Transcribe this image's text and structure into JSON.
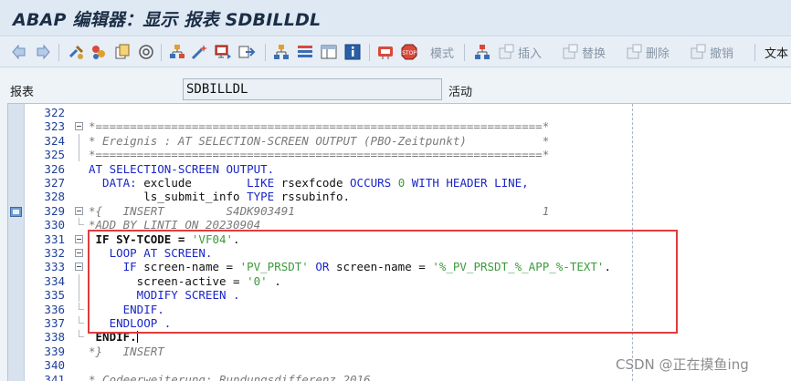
{
  "window": {
    "title": "ABAP 编辑器：显示 报表 SDBILLDL"
  },
  "toolbar": {
    "icons": [
      "back-arrow-icon",
      "forward-arrow-icon",
      "tools-icon",
      "object-list-icon",
      "copy-icon",
      "navigate-icon",
      "hierarchy-icon",
      "magic-wand-icon",
      "screen-icon",
      "enter-icon",
      "tree-icon",
      "list-icon",
      "panel-icon",
      "info-icon",
      "pattern-icon",
      "stop-icon",
      "insert-icon",
      "replace-icon",
      "delete-icon",
      "undo-icon"
    ],
    "pattern_label": "模式",
    "insert_label": "插入",
    "replace_label": "替换",
    "delete_label": "删除",
    "undo_label": "撤销",
    "text_label": "文本"
  },
  "program": {
    "label": "报表",
    "name": "SDBILLDL",
    "status": "活动"
  },
  "code_lines": [
    {
      "n": "322",
      "parts": []
    },
    {
      "n": "323",
      "parts": [
        [
          "cm",
          "*=================================================================*"
        ]
      ]
    },
    {
      "n": "324",
      "parts": [
        [
          "cm",
          "* Ereignis : AT SELECTION-SCREEN OUTPUT (PBO-Zeitpunkt)           *"
        ]
      ]
    },
    {
      "n": "325",
      "parts": [
        [
          "cm",
          "*=================================================================*"
        ]
      ]
    },
    {
      "n": "326",
      "parts": [
        [
          "kw",
          "AT SELECTION-SCREEN OUTPUT."
        ]
      ]
    },
    {
      "n": "327",
      "parts": [
        [
          "kw",
          "  DATA: "
        ],
        [
          "tx",
          "exclude        "
        ],
        [
          "kw",
          "LIKE "
        ],
        [
          "tx",
          "rsexfcode "
        ],
        [
          "kw",
          "OCCURS "
        ],
        [
          "nm",
          "0 "
        ],
        [
          "kw",
          "WITH HEADER LINE,"
        ]
      ]
    },
    {
      "n": "328",
      "parts": [
        [
          "tx",
          "        ls_submit_info "
        ],
        [
          "kw",
          "TYPE "
        ],
        [
          "tx",
          "rssubinfo."
        ]
      ]
    },
    {
      "n": "329",
      "parts": [
        [
          "cm",
          "*{   INSERT         S4DK903491                                    1"
        ]
      ]
    },
    {
      "n": "330",
      "parts": [
        [
          "cm",
          "*ADD BY LINTI ON 20230904"
        ]
      ]
    },
    {
      "n": "331",
      "parts": [
        [
          "bold",
          " IF SY-TCODE = "
        ],
        [
          "st",
          "'VF04'"
        ],
        [
          "tx",
          "."
        ]
      ]
    },
    {
      "n": "332",
      "parts": [
        [
          "kw",
          "   LOOP AT SCREEN."
        ]
      ]
    },
    {
      "n": "333",
      "parts": [
        [
          "kw",
          "     IF "
        ],
        [
          "tx",
          "screen-name = "
        ],
        [
          "st",
          "'PV_PRSDT' "
        ],
        [
          "kw",
          "OR "
        ],
        [
          "tx",
          "screen-name = "
        ],
        [
          "st",
          "'%_PV_PRSDT_%_APP_%-TEXT'"
        ],
        [
          "tx",
          "."
        ]
      ]
    },
    {
      "n": "334",
      "parts": [
        [
          "tx",
          "       screen-active = "
        ],
        [
          "st",
          "'0' "
        ],
        [
          "tx",
          "."
        ]
      ]
    },
    {
      "n": "335",
      "parts": [
        [
          "kw",
          "       MODIFY SCREEN ."
        ]
      ]
    },
    {
      "n": "336",
      "parts": [
        [
          "kw",
          "     ENDIF."
        ]
      ]
    },
    {
      "n": "337",
      "parts": [
        [
          "kw",
          "   ENDLOOP ."
        ]
      ]
    },
    {
      "n": "338",
      "parts": [
        [
          "bold",
          " ENDIF."
        ]
      ]
    },
    {
      "n": "339",
      "parts": [
        [
          "cm",
          "*}   INSERT"
        ]
      ]
    },
    {
      "n": "340",
      "parts": []
    },
    {
      "n": "341",
      "parts": [
        [
          "cm",
          "* Codeerweiterung: Rundungsdifferenz 2016"
        ]
      ]
    }
  ],
  "watermark": "CSDN @正在摸鱼ing",
  "colors": {
    "keyword": "#1a26c9",
    "string": "#3c9a3c",
    "comment": "#7a7a7a",
    "highlight_box": "#e23b3b"
  }
}
